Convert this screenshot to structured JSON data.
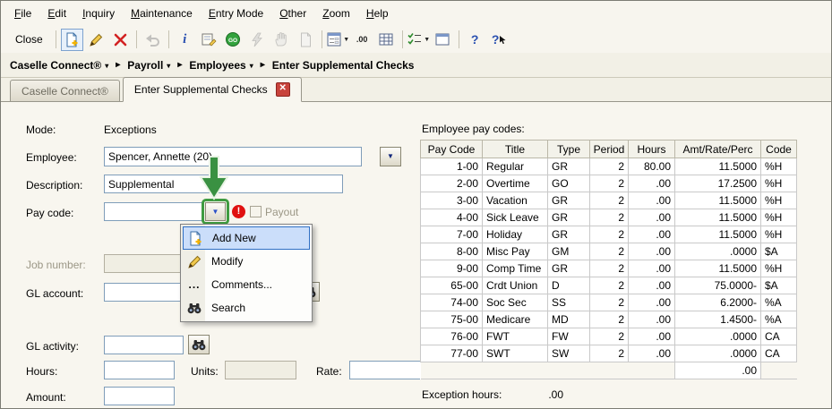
{
  "menu": {
    "items": [
      {
        "label": "File",
        "accel": 0
      },
      {
        "label": "Edit",
        "accel": 0
      },
      {
        "label": "Inquiry",
        "accel": 0
      },
      {
        "label": "Maintenance",
        "accel": 0
      },
      {
        "label": "Entry Mode",
        "accel": 0
      },
      {
        "label": "Other",
        "accel": 0
      },
      {
        "label": "Zoom",
        "accel": 0
      },
      {
        "label": "Help",
        "accel": 0
      }
    ]
  },
  "toolbar": {
    "close_label": "Close",
    "items": [
      {
        "sep": true
      },
      {
        "name": "new-record-icon",
        "pressed": true
      },
      {
        "name": "edit-record-icon"
      },
      {
        "name": "delete-record-icon"
      },
      {
        "sep": true
      },
      {
        "name": "undo-icon",
        "disabled": true
      },
      {
        "sep": true
      },
      {
        "name": "info-icon"
      },
      {
        "name": "notes-icon"
      },
      {
        "name": "go-icon"
      },
      {
        "name": "lightning-icon",
        "disabled": true
      },
      {
        "name": "hand-icon",
        "disabled": true
      },
      {
        "name": "document-icon",
        "disabled": true
      },
      {
        "sep": true
      },
      {
        "name": "form-view-icon",
        "dropdown": true
      },
      {
        "name": "decimal-icon"
      },
      {
        "name": "grid-icon"
      },
      {
        "sep": true
      },
      {
        "name": "checklist-icon",
        "dropdown": true
      },
      {
        "name": "window-icon"
      },
      {
        "sep": true
      },
      {
        "name": "help-icon"
      },
      {
        "name": "context-help-icon"
      }
    ]
  },
  "breadcrumb": {
    "items": [
      "Caselle Connect®",
      "Payroll",
      "Employees"
    ],
    "current": "Enter Supplemental Checks"
  },
  "tabs": [
    {
      "label": "Caselle Connect®",
      "active": false,
      "closable": false
    },
    {
      "label": "Enter Supplemental Checks",
      "active": true,
      "closable": true
    }
  ],
  "form": {
    "mode_label": "Mode:",
    "mode_value": "Exceptions",
    "employee_label": "Employee:",
    "employee_value": "Spencer, Annette (20)",
    "description_label": "Description:",
    "description_value": "Supplemental",
    "paycode_label": "Pay code:",
    "paycode_value": "",
    "payout_label": "Payout",
    "job_label": "Job number:",
    "job_value": "",
    "gl_account_label": "GL account:",
    "gl_account_value": "",
    "gl_activity_label": "GL activity:",
    "gl_activity_value": "",
    "hours_label": "Hours:",
    "hours_value": "",
    "units_label": "Units:",
    "units_value": "",
    "rate_label": "Rate:",
    "rate_value": "",
    "amount_label": "Amount:",
    "amount_value": ""
  },
  "context_menu": {
    "items": [
      {
        "label": "Add New",
        "icon": "add-new-icon",
        "selected": true
      },
      {
        "label": "Modify",
        "icon": "pencil-icon",
        "selected": false
      },
      {
        "label": "Comments...",
        "icon": "ellipsis-icon",
        "selected": false
      },
      {
        "label": "Search",
        "icon": "binoculars-icon",
        "selected": false
      }
    ]
  },
  "pay_codes": {
    "title": "Employee pay codes:",
    "columns": [
      "Pay Code",
      "Title",
      "Type",
      "Period",
      "Hours",
      "Amt/Rate/Perc",
      "Code"
    ],
    "rows": [
      [
        "1-00",
        "Regular",
        "GR",
        "2",
        "80.00",
        "11.5000",
        "%H"
      ],
      [
        "2-00",
        "Overtime",
        "GO",
        "2",
        ".00",
        "17.2500",
        "%H"
      ],
      [
        "3-00",
        "Vacation",
        "GR",
        "2",
        ".00",
        "11.5000",
        "%H"
      ],
      [
        "4-00",
        "Sick Leave",
        "GR",
        "2",
        ".00",
        "11.5000",
        "%H"
      ],
      [
        "7-00",
        "Holiday",
        "GR",
        "2",
        ".00",
        "11.5000",
        "%H"
      ],
      [
        "8-00",
        "Misc Pay",
        "GM",
        "2",
        ".00",
        ".0000",
        "$A"
      ],
      [
        "9-00",
        "Comp Time",
        "GR",
        "2",
        ".00",
        "11.5000",
        "%H"
      ],
      [
        "65-00",
        "Crdt Union",
        "D",
        "2",
        ".00",
        "75.0000-",
        "$A"
      ],
      [
        "74-00",
        "Soc Sec",
        "SS",
        "2",
        ".00",
        "6.2000-",
        "%A"
      ],
      [
        "75-00",
        "Medicare",
        "MD",
        "2",
        ".00",
        "1.4500-",
        "%A"
      ],
      [
        "76-00",
        "FWT",
        "FW",
        "2",
        ".00",
        ".0000",
        "CA"
      ],
      [
        "77-00",
        "SWT",
        "SW",
        "2",
        ".00",
        ".0000",
        "CA"
      ]
    ],
    "total_amt": ".00",
    "exception_hours_label": "Exception hours:",
    "exception_hours_value": ".00"
  },
  "colors": {
    "annotation_green": "#3f9b41",
    "selection_blue": "#cbdefa",
    "error_red": "#e01010"
  }
}
